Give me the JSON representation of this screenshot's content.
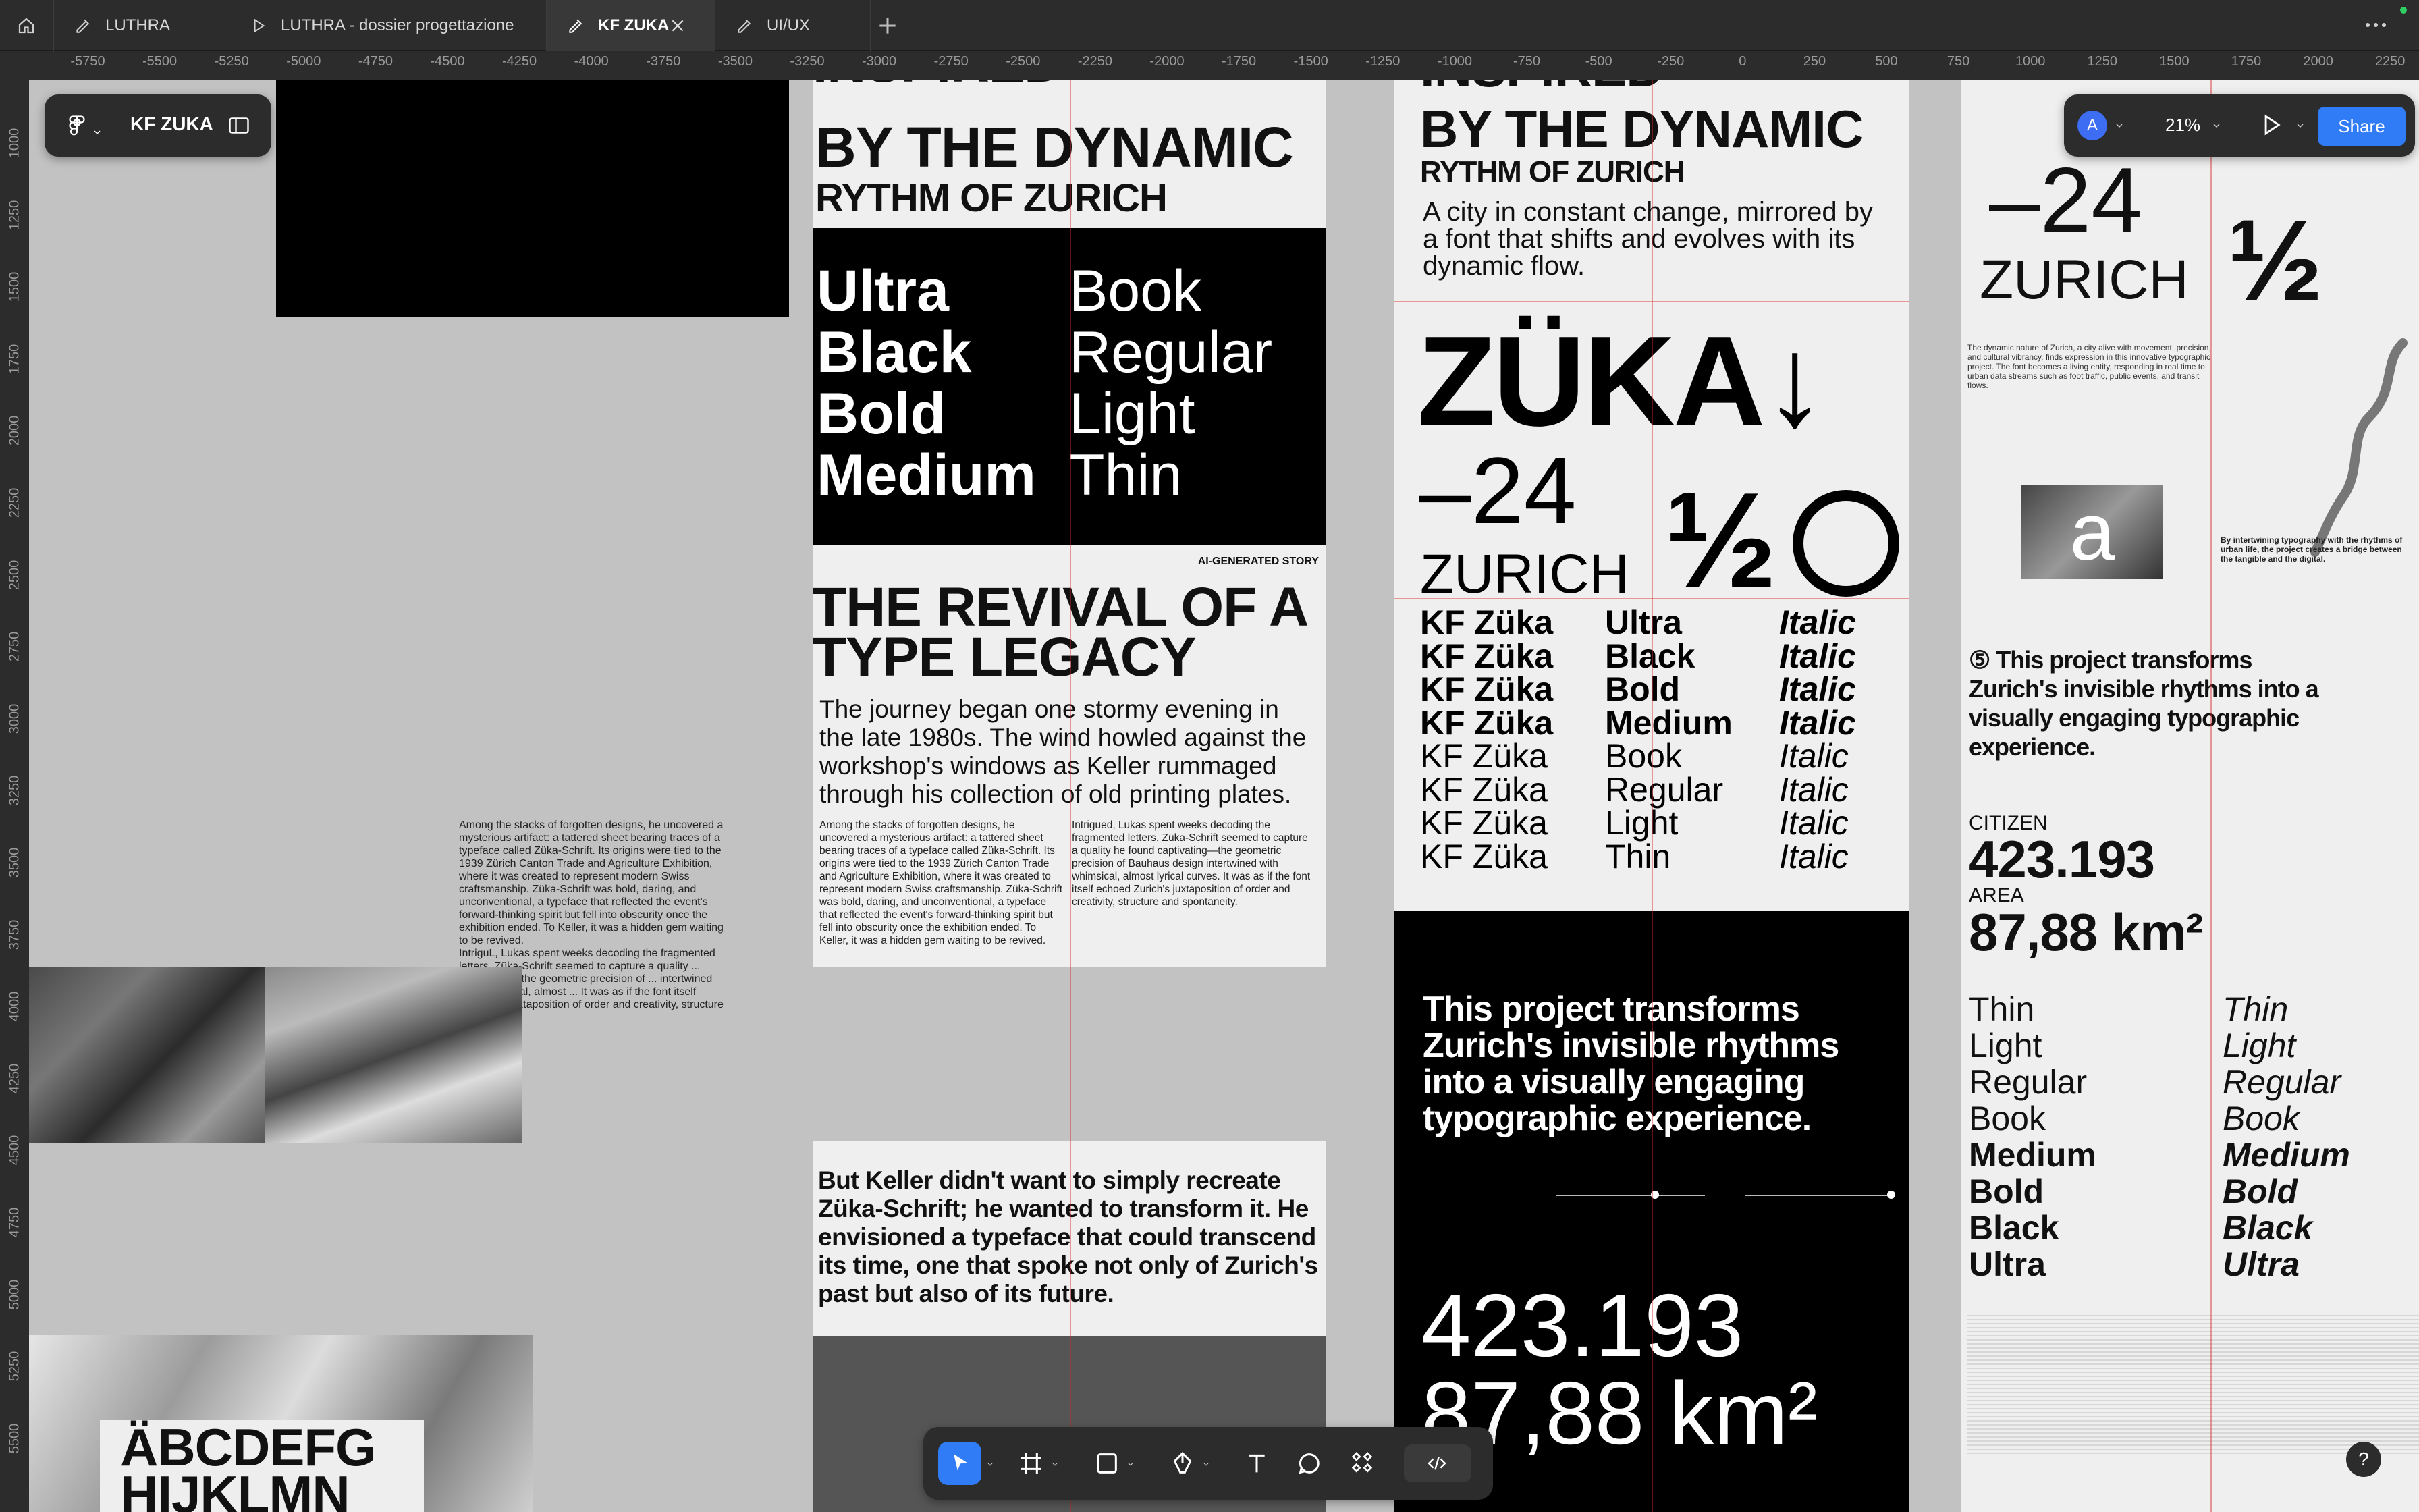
{
  "tabs": [
    {
      "label": "LUTHRA"
    },
    {
      "label": "LUTHRA - dossier progettazione"
    },
    {
      "label": "KF ZUKA"
    },
    {
      "label": "UI/UX"
    }
  ],
  "ruler_top": [
    "-5750",
    "-5500",
    "-5250",
    "-5000",
    "-4750",
    "-4500",
    "-4250",
    "-4000",
    "-3750",
    "-3500",
    "-3250",
    "-3000",
    "-2750",
    "-2500",
    "-2250",
    "-2000",
    "-1750",
    "-1500",
    "-1250",
    "-1000",
    "-750",
    "-500",
    "-250",
    "0",
    "250",
    "500",
    "750",
    "1000",
    "1250",
    "1500",
    "1750",
    "2000",
    "2250"
  ],
  "ruler_left": [
    "1000",
    "1250",
    "1500",
    "1750",
    "2000",
    "2250",
    "2500",
    "2750",
    "3000",
    "3250",
    "3500",
    "3750",
    "4000",
    "4250",
    "4500",
    "4750",
    "5000",
    "5250",
    "5500"
  ],
  "file_panel": {
    "name": "KF ZUKA"
  },
  "right_panel": {
    "avatar": "A",
    "zoom": "21%",
    "share": "Share"
  },
  "frame1": {
    "story": "Among the stacks of forgotten designs, he uncovered a mysterious artifact: a tattered sheet bearing traces of a typeface called Züka-Schrift. Its origins were tied to the 1939 Zürich Canton Trade and Agriculture Exhibition, where it was created to represent modern Swiss craftsmanship. Züka-Schrift was bold, daring, and unconventional, a typeface that reflected the event's forward-thinking spirit but fell into obscurity once the exhibition ended. To Keller, it was a hidden gem waiting to be revived.\nIntriguL, Lukas spent weeks decoding the fragmented letters. Züka-Schrift seemed to capture a quality ... captivating—the geometric precision of ... intertwined with whimsical, almost ... It was as if the font itself echoed ... juxtaposition of order and creativity, structure ... ity.",
    "abc1": "ÄBCDEFG",
    "abc2": "HIJKLMN"
  },
  "frame2": {
    "head1": "BY THE DYNAMIC",
    "head2": "RYTHM OF ZURICH",
    "weights_left": [
      "Ultra",
      "Black",
      "Bold",
      "Medium"
    ],
    "weights_right": [
      "Book",
      "Regular",
      "Light",
      "Thin"
    ],
    "tag": "AI-GENERATED STORY",
    "title": "THE REVIVAL OF A TYPE LEGACY",
    "lead": "The journey began one stormy evening in the late 1980s. The wind howled against the workshop's windows as Keller rummaged through his collection of old printing plates.",
    "col1": "Among the stacks of forgotten designs, he uncovered a mysterious artifact: a tattered sheet bearing traces of a typeface called Züka-Schrift. Its origins were tied to the 1939 Zürich Canton Trade and Agriculture Exhibition, where it was created to represent modern Swiss craftsmanship. Züka-Schrift was bold, daring, and unconventional, a typeface that reflected the event's forward-thinking spirit but fell into obscurity once the exhibition ended. To Keller, it was a hidden gem waiting to be revived.",
    "col2": "Intrigued, Lukas spent weeks decoding the fragmented letters. Züka-Schrift seemed to capture a quality he found captivating—the geometric precision of Bauhaus design intertwined with whimsical, almost lyrical curves. It was as if the font itself echoed Zurich's juxtaposition of order and creativity, structure and spontaneity.",
    "quote": "But Keller didn't want to simply recreate Züka-Schrift; he wanted to transform it. He envisioned a typeface that could transcend its time, one that spoke not only of Zurich's past but also of its future."
  },
  "frame3": {
    "head1": "BY THE DYNAMIC",
    "head2": "RYTHM OF ZURICH",
    "sub": "A city in constant change, mirrored by a font that shifts and evolves with its dynamic flow.",
    "zuka": "ZÜKA↓",
    "minus24": "–24",
    "half": "½",
    "zurich": "ZURICH",
    "specimen_col1": [
      "KF Züka",
      "KF Züka",
      "KF Züka",
      "KF Züka",
      "KF Züka",
      "KF Züka",
      "KF Züka",
      "KF Züka"
    ],
    "specimen_col2": [
      "Ultra",
      "Black",
      "Bold",
      "Medium",
      "Book",
      "Regular",
      "Light",
      "Thin"
    ],
    "specimen_col3": [
      "Italic",
      "Italic",
      "Italic",
      "Italic",
      "Italic",
      "Italic",
      "Italic",
      "Italic"
    ],
    "statement": "This project transforms Zurich's invisible rhythms into a visually engaging typographic experience.",
    "num1": "423.193",
    "num2": "87,88 km²"
  },
  "frame4": {
    "minus24": "–24",
    "zurich": "ZURICH",
    "half": "½",
    "body": "The dynamic nature of Zurich, a city alive with movement, precision, and cultural vibrancy, finds expression in this innovative typographic project. The font becomes a living entity, responding in real time to urban data streams such as foot traffic, public events, and transit flows.",
    "caption": "By intertwining typography with the rhythms of urban life, the project creates a bridge between the tangible and the digital.",
    "statement": "⑤ This project transforms Zurich's invisible rhythms into a visually engaging typographic experience.",
    "citizen_label": "CITIZEN",
    "citizen_value": "423.193",
    "area_label": "AREA",
    "area_value": "87,88 km²",
    "weights": [
      "Thin",
      "Light",
      "Regular",
      "Book",
      "Medium",
      "Bold",
      "Black",
      "Ultra"
    ]
  },
  "toolbar": {
    "help": "?"
  }
}
